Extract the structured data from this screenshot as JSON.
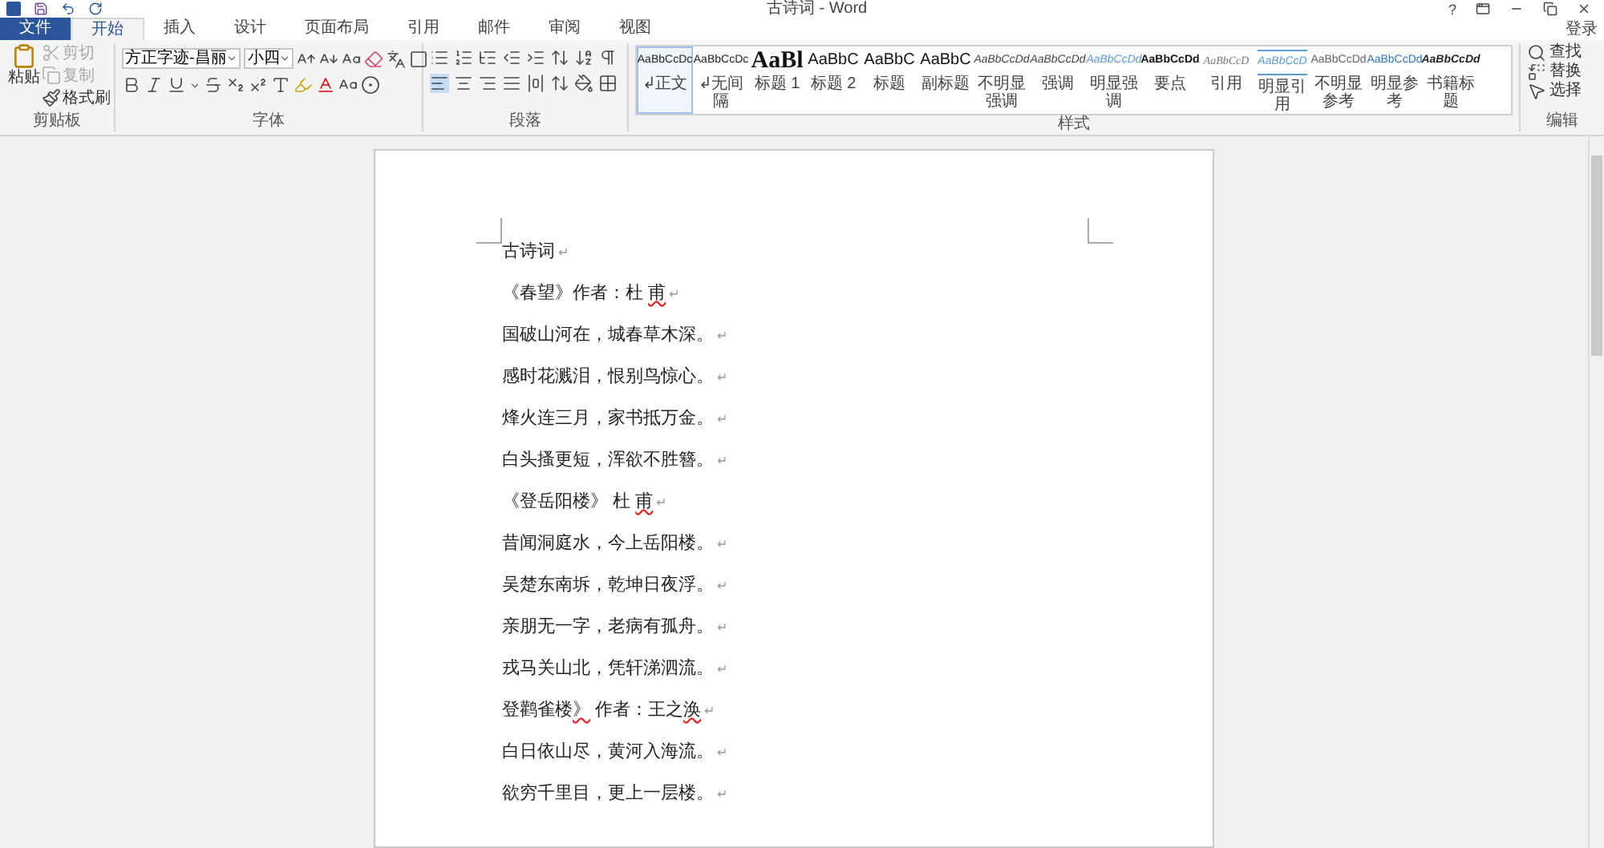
{
  "window": {
    "title": "古诗词 - Word",
    "help": "?"
  },
  "tabs": [
    {
      "label": "文件",
      "kind": "file",
      "selected": false
    },
    {
      "label": "开始",
      "kind": "tab",
      "selected": true
    },
    {
      "label": "插入",
      "kind": "tab",
      "selected": false
    },
    {
      "label": "设计",
      "kind": "tab",
      "selected": false
    },
    {
      "label": "页面布局",
      "kind": "tab",
      "selected": false
    },
    {
      "label": "引用",
      "kind": "tab",
      "selected": false
    },
    {
      "label": "邮件",
      "kind": "tab",
      "selected": false
    },
    {
      "label": "审阅",
      "kind": "tab",
      "selected": false
    },
    {
      "label": "视图",
      "kind": "tab",
      "selected": false
    }
  ],
  "sign_in": "登录",
  "clipboard": {
    "label": "剪贴板",
    "paste": "粘贴",
    "items": [
      {
        "label": "剪切",
        "disabled": true
      },
      {
        "label": "复制",
        "disabled": true
      },
      {
        "label": "格式刷",
        "disabled": false
      }
    ]
  },
  "font": {
    "label": "字体",
    "font_name": "方正字迹-昌丽",
    "font_size": "小四"
  },
  "paragraph": {
    "label": "段落"
  },
  "styles": {
    "label": "样式",
    "items": [
      {
        "preview": "AaBbCcDc",
        "label": "正文",
        "kind": "plain",
        "marker": "↲",
        "selected": true
      },
      {
        "preview": "AaBbCcDc",
        "label": "无间隔",
        "kind": "plain",
        "marker": "↲",
        "selected": false
      },
      {
        "preview": "AaBl",
        "label": "标题 1",
        "kind": "huge",
        "selected": false
      },
      {
        "preview": "AaBbC",
        "label": "标题 2",
        "kind": "large",
        "selected": false
      },
      {
        "preview": "AaBbC",
        "label": "标题",
        "kind": "large",
        "selected": false
      },
      {
        "preview": "AaBbC",
        "label": "副标题",
        "kind": "large",
        "selected": false
      },
      {
        "preview": "AaBbCcDd",
        "label": "不明显强调",
        "kind": "italic",
        "selected": false
      },
      {
        "preview": "AaBbCcDd",
        "label": "强调",
        "kind": "italic",
        "selected": false
      },
      {
        "preview": "AaBbCcDd",
        "label": "明显强调",
        "kind": "blue-italic",
        "selected": false
      },
      {
        "preview": "AaBbCcDd",
        "label": "要点",
        "kind": "bold",
        "selected": false
      },
      {
        "preview": "AaBbCcD",
        "label": "引用",
        "kind": "gray-italic",
        "selected": false
      },
      {
        "preview": "AaBbCcD",
        "label": "明显引用",
        "kind": "quote",
        "selected": false
      },
      {
        "preview": "AaBbCcDd",
        "label": "不明显参考",
        "kind": "caps",
        "selected": false
      },
      {
        "preview": "AaBbCcDd",
        "label": "明显参考",
        "kind": "blue-caps",
        "selected": false
      },
      {
        "preview": "AaBbCcDd",
        "label": "书籍标题",
        "kind": "bold-italic",
        "selected": false
      }
    ]
  },
  "editing": {
    "label": "编辑",
    "items": [
      {
        "label": "查找",
        "kind": "find"
      },
      {
        "label": "替换",
        "kind": "replace"
      },
      {
        "label": "选择",
        "kind": "select"
      }
    ]
  },
  "document": {
    "lines": [
      {
        "segments": [
          {
            "text": "古诗词",
            "misspelled": false
          }
        ],
        "mark": "↵"
      },
      {
        "segments": [
          {
            "text": "《春望》作者：杜 ",
            "misspelled": false
          },
          {
            "text": "甫",
            "misspelled": true
          }
        ],
        "mark": "↵"
      },
      {
        "segments": [
          {
            "text": "国破山河在，城春草木深。",
            "misspelled": false
          }
        ],
        "mark": "↵"
      },
      {
        "segments": [
          {
            "text": "感时花溅泪，恨别鸟惊心。",
            "misspelled": false
          }
        ],
        "mark": "↵"
      },
      {
        "segments": [
          {
            "text": "烽火连三月，家书抵万金。",
            "misspelled": false
          }
        ],
        "mark": "↵"
      },
      {
        "segments": [
          {
            "text": "白头搔更短，浑欲不胜簪。",
            "misspelled": false
          }
        ],
        "mark": "↵"
      },
      {
        "segments": [
          {
            "text": "《登岳阳楼》 杜 ",
            "misspelled": false
          },
          {
            "text": "甫",
            "misspelled": true
          }
        ],
        "mark": "↵"
      },
      {
        "segments": [
          {
            "text": "昔闻洞庭水，今上岳阳楼。",
            "misspelled": false
          }
        ],
        "mark": "↵"
      },
      {
        "segments": [
          {
            "text": "吴楚东南坼，乾坤日夜浮。",
            "misspelled": false
          }
        ],
        "mark": "↵"
      },
      {
        "segments": [
          {
            "text": "亲朋无一字，老病有孤舟。",
            "misspelled": false
          }
        ],
        "mark": "↵"
      },
      {
        "segments": [
          {
            "text": "戎马关山北，凭轩涕泗流。",
            "misspelled": false
          }
        ],
        "mark": "↵"
      },
      {
        "segments": [
          {
            "text": "登鹳雀楼",
            "misspelled": false
          },
          {
            "text": "》",
            "misspelled": true
          },
          {
            "text": " 作者：王之",
            "misspelled": false
          },
          {
            "text": "涣",
            "misspelled": true
          }
        ],
        "mark": "↵"
      },
      {
        "segments": [
          {
            "text": "白日依山尽，黄河入海流。",
            "misspelled": false
          }
        ],
        "mark": "↵"
      },
      {
        "segments": [
          {
            "text": "欲穷千里目，更上一层楼。",
            "misspelled": false
          }
        ],
        "mark": "↵"
      }
    ]
  }
}
